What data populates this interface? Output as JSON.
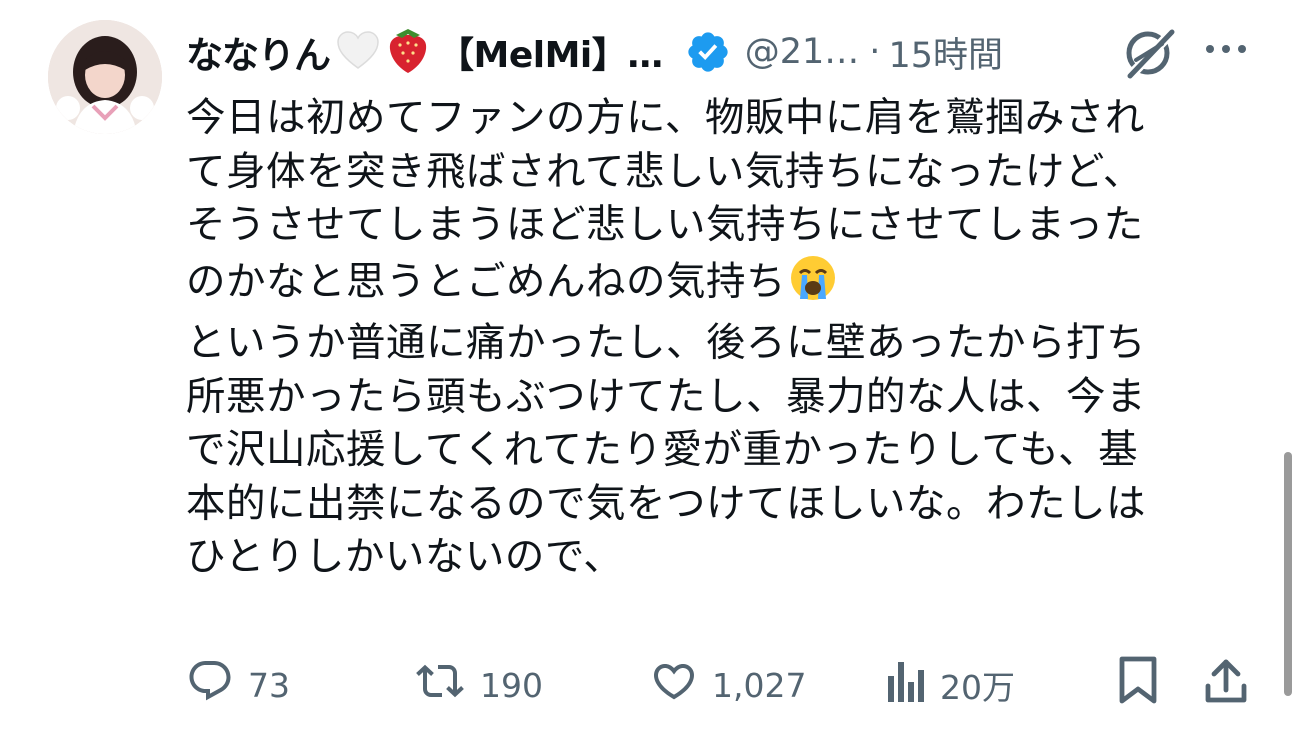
{
  "tweet": {
    "display_name": "ななりん",
    "brand": "【MelMi】…",
    "handle": "@21…",
    "separator": "·",
    "time": "15時間",
    "lines": [
      "今日は初めてファンの方に、物販中に肩を鷲掴みされ",
      "て身体を突き飛ばされて悲しい気持ちになったけど、",
      "そうさせてしまうほど悲しい気持ちにさせてしまった",
      "のかなと思うとごめんねの気持ち",
      "というか普通に痛かったし、後ろに壁あったから打ち",
      "所悪かったら頭もぶつけてたし、暴力的な人は、今ま",
      "で沢山応援してくれてたり愛が重かったりしても、基",
      "本的に出禁になるので気をつけてほしいな。わたしは",
      "ひとりしかいないので、"
    ]
  },
  "actions": {
    "replies": "73",
    "reposts": "190",
    "likes": "1,027",
    "views": "20万"
  },
  "icons": {
    "heart_emoji": "white-heart-icon",
    "strawberry_emoji": "strawberry-icon",
    "verified": "verified-badge-icon",
    "grok": "grok-icon",
    "more": "more-icon",
    "crying_emoji": "crying-face-icon",
    "reply": "reply-icon",
    "repost": "repost-icon",
    "like": "like-icon",
    "views": "views-icon",
    "bookmark": "bookmark-icon",
    "share": "share-icon"
  },
  "colors": {
    "text": "#0f1419",
    "secondary": "#536471",
    "verified": "#1d9bf0"
  }
}
